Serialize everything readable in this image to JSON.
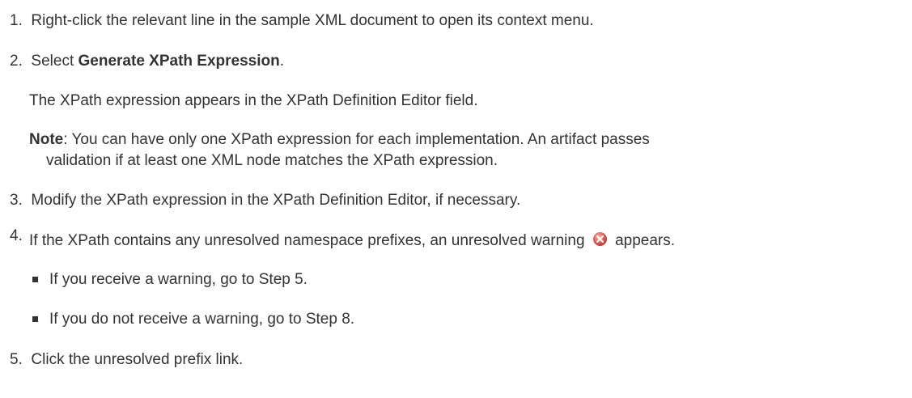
{
  "steps": [
    {
      "number": "1.",
      "text": "Right-click the relevant line in the sample XML document to open its context menu."
    },
    {
      "number": "2.",
      "prefix": "Select ",
      "bold": "Generate XPath Expression",
      "suffix": "."
    },
    {
      "number": "3.",
      "text": "Modify the XPath expression in the XPath Definition Editor, if necessary."
    },
    {
      "number": "4.",
      "text_before_icon": "If the XPath contains any unresolved namespace prefixes, an unresolved warning",
      "text_after_icon": "appears.",
      "icon": "unresolved-warning-icon",
      "bullets": [
        "If you receive a warning, go to Step 5.",
        "If you do not receive a warning, go to Step 8."
      ]
    },
    {
      "number": "5.",
      "text": "Click the unresolved prefix link."
    }
  ],
  "step2_result": "The XPath expression appears in the XPath Definition Editor field.",
  "note": {
    "label": "Note",
    "text_line1": ": You can have only one XPath expression for each implementation. An artifact passes",
    "text_line2": "validation if at least one XML node matches the XPath expression."
  },
  "colors": {
    "text": "#333333",
    "icon_red": "#d9534f"
  }
}
